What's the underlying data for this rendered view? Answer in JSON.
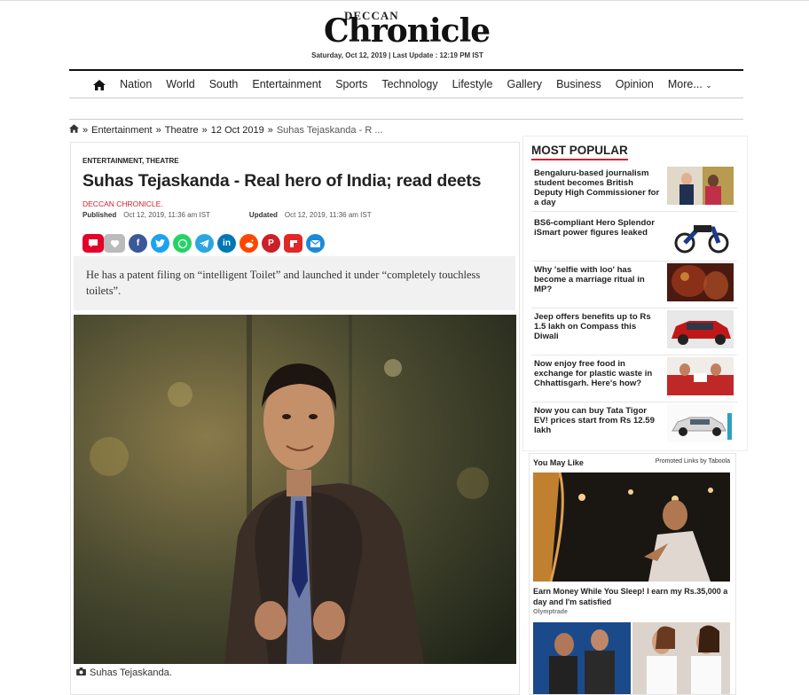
{
  "masthead": {
    "brand_top": "DECCAN",
    "brand_main": "Chronicle",
    "dateline": "Saturday, Oct 12, 2019 | Last Update : 12:19 PM IST"
  },
  "nav": {
    "items": [
      "Nation",
      "World",
      "South",
      "Entertainment",
      "Sports",
      "Technology",
      "Lifestyle",
      "Gallery",
      "Business",
      "Opinion",
      "More..."
    ]
  },
  "breadcrumb": {
    "items": [
      "Entertainment",
      "Theatre",
      "12 Oct 2019"
    ],
    "current": "Suhas Tejaskanda - R ..."
  },
  "article": {
    "categories": "ENTERTAINMENT, THEATRE",
    "headline": "Suhas Tejaskanda - Real hero of India; read deets",
    "author": "DECCAN CHRONICLE.",
    "published_label": "Published",
    "published": "Oct 12, 2019, 11:36 am IST",
    "updated_label": "Updated",
    "updated": "Oct 12, 2019, 11:36 am IST",
    "summary": "He has a patent filing on “intelligent Toilet” and launched it under “completely touchless toilets”.",
    "caption": "Suhas Tejaskanda."
  },
  "share": {
    "icons": [
      "comment-icon",
      "like-icon",
      "facebook-icon",
      "twitter-icon",
      "whatsapp-icon",
      "telegram-icon",
      "linkedin-icon",
      "reddit-icon",
      "pinterest-icon",
      "flipboard-icon",
      "email-icon"
    ],
    "colors": {
      "facebook": "#3b5998",
      "twitter": "#1da1f2",
      "whatsapp": "#25d366",
      "telegram": "#2ca5e0",
      "linkedin": "#0077b5",
      "reddit": "#ff4500",
      "pinterest": "#cb2027",
      "flipboard": "#e12828",
      "email": "#1a8ad8"
    }
  },
  "most_popular": {
    "title": "MOST POPULAR",
    "items": [
      {
        "title": "Bengaluru-based journalism student becomes British Deputy High Commissioner for a day"
      },
      {
        "title": "BS6-compliant Hero Splendor iSmart power figures leaked"
      },
      {
        "title": "Why 'selfie with loo' has become a marriage ritual in MP?"
      },
      {
        "title": "Jeep offers benefits up to Rs 1.5 lakh on Compass this Diwali"
      },
      {
        "title": "Now enjoy free food in exchange for plastic waste in Chhattisgarh. Here's how?"
      },
      {
        "title": "Now you can buy Tata Tigor EV! prices start from Rs 12.59 lakh"
      }
    ]
  },
  "you_may_like": {
    "title": "You May Like",
    "promoted": "Promoted Links by Taboola",
    "ad_title": "Earn Money While You Sleep! I earn my Rs.35,000 a day and I'm satisfied",
    "ad_source": "Olymptrade"
  },
  "colors": {
    "accent": "#d2232a"
  }
}
